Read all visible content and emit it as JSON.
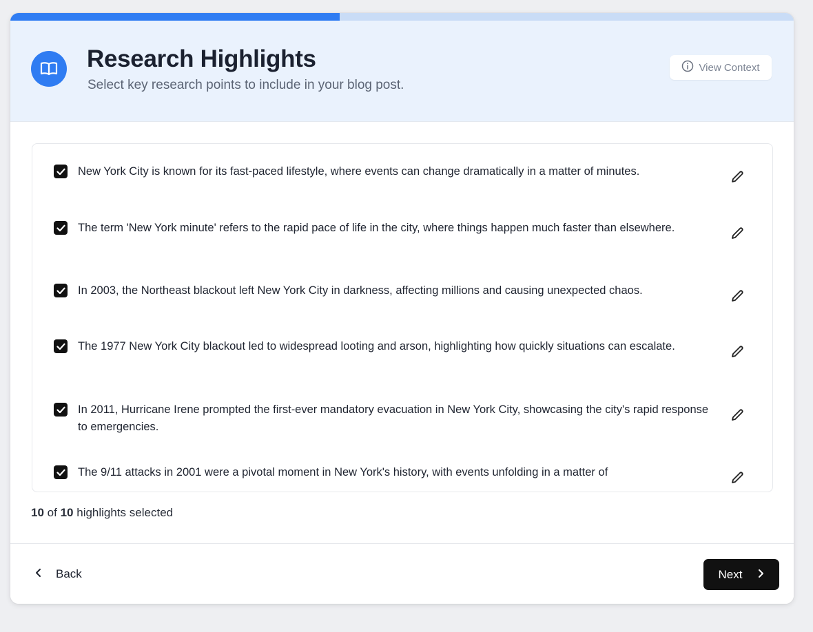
{
  "progress": {
    "value": 0.42
  },
  "header": {
    "title": "Research Highlights",
    "subtitle": "Select key research points to include in your blog post.",
    "view_context_label": "View Context",
    "icon": "book-open-icon"
  },
  "highlights": [
    {
      "text": "New York City is known for its fast-paced lifestyle, where events can change dramatically in a matter of minutes.",
      "checked": true
    },
    {
      "text": "The term 'New York minute' refers to the rapid pace of life in the city, where things happen much faster than elsewhere.",
      "checked": true
    },
    {
      "text": "In 2003, the Northeast blackout left New York City in darkness, affecting millions and causing unexpected chaos.",
      "checked": true
    },
    {
      "text": "The 1977 New York City blackout led to widespread looting and arson, highlighting how quickly situations can escalate.",
      "checked": true
    },
    {
      "text": "In 2011, Hurricane Irene prompted the first-ever mandatory evacuation in New York City, showcasing the city's rapid response to emergencies.",
      "checked": true
    },
    {
      "text": "The 9/11 attacks in 2001 were a pivotal moment in New York's history, with events unfolding in a matter of",
      "checked": true
    }
  ],
  "selection": {
    "selected": "10",
    "of": "of",
    "total": "10",
    "suffix": "highlights selected"
  },
  "footer": {
    "back_label": "Back",
    "next_label": "Next"
  },
  "colors": {
    "accent": "#2f7cf2",
    "header_bg": "#eaf2fd",
    "primary_button": "#111111"
  }
}
